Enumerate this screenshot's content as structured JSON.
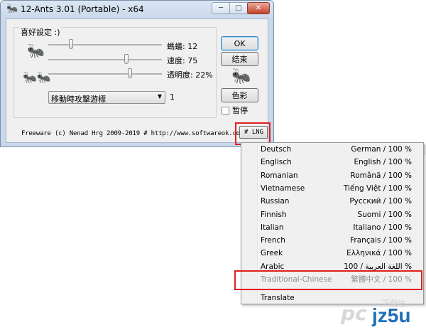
{
  "window": {
    "title": "12-Ants 3.01 (Portable) - x64",
    "title_icon": "ant-icon",
    "controls": {
      "minimize": "─",
      "maximize": "□",
      "close": "✕"
    }
  },
  "settings": {
    "group_label": "喜好設定 :)",
    "sliders": [
      {
        "label": "螞蟻",
        "value_text": "12",
        "level": 0.2
      },
      {
        "label": "速度",
        "value_text": "75",
        "level": 0.69
      },
      {
        "label": "透明度",
        "value_text": "22%",
        "level": 0.72
      }
    ],
    "dropdown": {
      "selected": "移動時攻擊游標",
      "number": "1"
    }
  },
  "buttons": {
    "ok": "OK",
    "exit": "结束",
    "color": "色彩"
  },
  "pause_checkbox": {
    "label": "暂停",
    "checked": false
  },
  "footer": {
    "text": "Freeware (c) Nenad Hrg 2009-2019 # http://www.softwareok.com",
    "lng_button": "# LNG"
  },
  "language_menu": {
    "items": [
      {
        "name": "Deutsch",
        "native": "German / 100 %"
      },
      {
        "name": "Englisch",
        "native": "English / 100 %"
      },
      {
        "name": "Romanian",
        "native": "Română / 100 %"
      },
      {
        "name": "Vietnamese",
        "native": "Tiếng Việt / 100 %"
      },
      {
        "name": "Russian",
        "native": "Русский / 100 %"
      },
      {
        "name": "Finnish",
        "native": "Suomi / 100 %"
      },
      {
        "name": "Italian",
        "native": "Italiano / 100 %"
      },
      {
        "name": "French",
        "native": "Français / 100 %"
      },
      {
        "name": "Greek",
        "native": "Ελληνικά / 100 %"
      },
      {
        "name": "Arabic",
        "native": "اللغة العربية / 100 %"
      },
      {
        "name": "Traditional-Chinese",
        "native": "繁體中文 / 100 %",
        "disabled": true
      }
    ],
    "translate_label": "Translate"
  },
  "watermark": {
    "left": "pc",
    "brand": "jz5u",
    "tag": "下载站"
  },
  "colors": {
    "highlight_box": "#e02020",
    "ok_border": "#3c7fb1"
  }
}
